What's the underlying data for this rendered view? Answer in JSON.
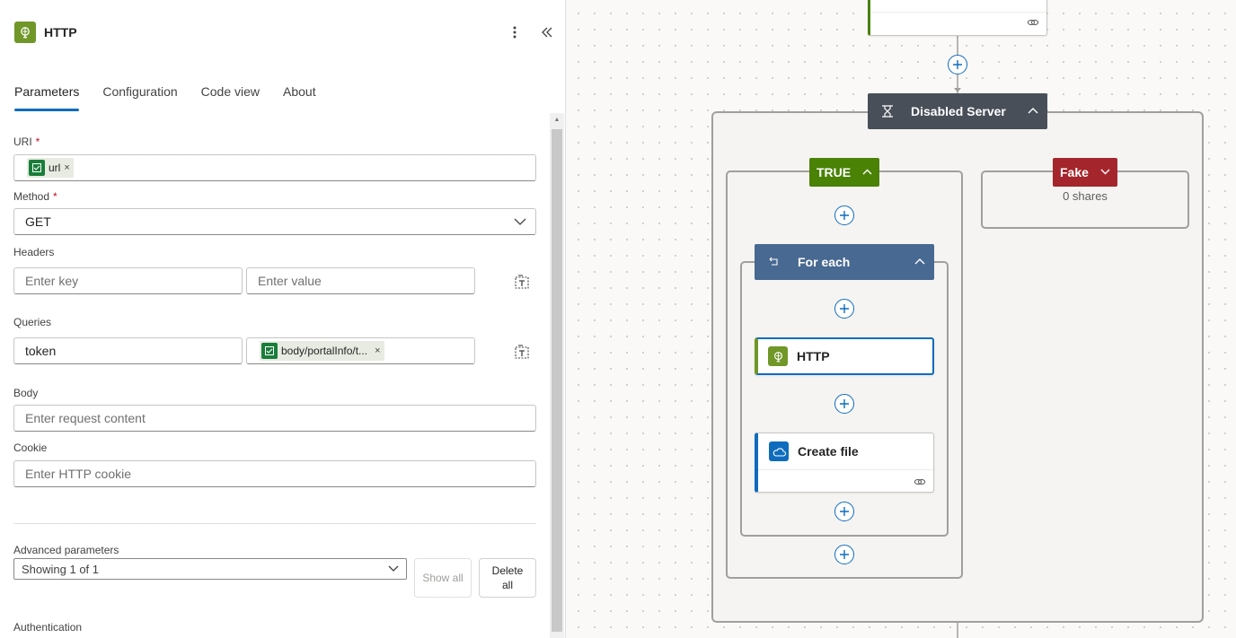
{
  "panel": {
    "title": "HTTP",
    "more_icon": "more-vertical-icon",
    "collapse_icon": "double-chevron-left-icon",
    "tabs": [
      {
        "label": "Parameters",
        "active": true
      },
      {
        "label": "Configuration"
      },
      {
        "label": "Code view"
      },
      {
        "label": "About"
      }
    ],
    "uri": {
      "label": "URI",
      "required": "*",
      "token": "url"
    },
    "method": {
      "label": "Method",
      "required": "*",
      "value": "GET"
    },
    "headers": {
      "label": "Headers",
      "key_placeholder": "Enter key",
      "value_placeholder": "Enter value"
    },
    "queries": {
      "label": "Queries",
      "key": "token",
      "value_token": "body/portalInfo/t..."
    },
    "body": {
      "label": "Body",
      "placeholder": "Enter request content"
    },
    "cookie": {
      "label": "Cookie",
      "placeholder": "Enter HTTP cookie"
    },
    "advanced": {
      "label": "Advanced parameters",
      "selected": "Showing 1 of 1",
      "show_all": "Show all",
      "delete_all": "Delete all"
    },
    "authentication": {
      "label": "Authentication"
    }
  },
  "canvas": {
    "condition": {
      "label": "Disabled Server",
      "color": "#484f58"
    },
    "true_branch": {
      "label": "TRUE",
      "color": "#498205"
    },
    "false_branch": {
      "label": "Fake",
      "color": "#a4262c",
      "subtitle": "0 shares"
    },
    "foreach": {
      "label": "For each",
      "color": "#486991"
    },
    "http_action": {
      "label": "HTTP",
      "icon": "globe-icon"
    },
    "create_file": {
      "label": "Create file",
      "icon": "onedrive-cloud-icon"
    },
    "colors": {
      "accent": "#0f6cbd",
      "http_green": "#709727"
    }
  }
}
